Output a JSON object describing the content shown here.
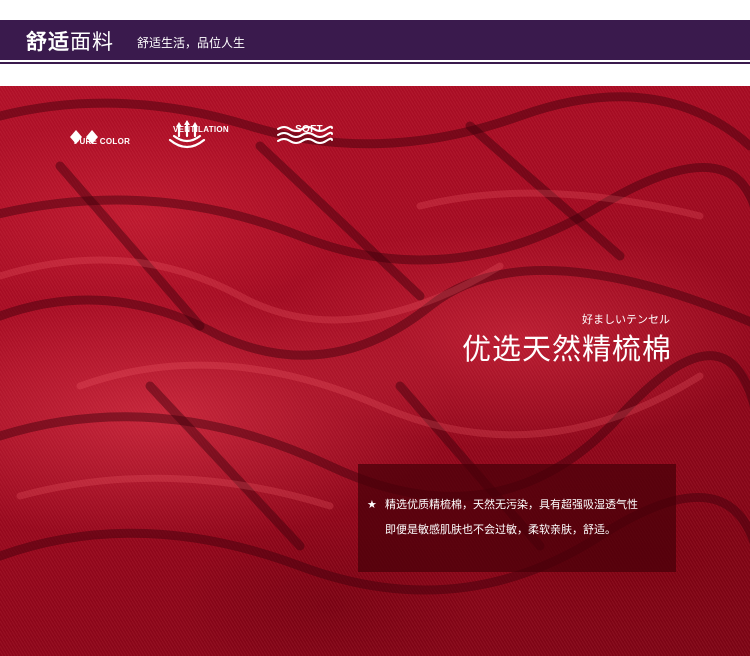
{
  "header": {
    "title_bold": "舒适",
    "title_normal": "面料",
    "subtitle": "舒适生活，品位人生"
  },
  "features": [
    {
      "icon": "diamonds-icon",
      "label": "PURE COLOR"
    },
    {
      "icon": "ventilation-icon",
      "label": "VENTILATION"
    },
    {
      "icon": "waves-icon",
      "label": "SOFT"
    }
  ],
  "fabric": {
    "kana": "好ましいテンセル",
    "title": "优选天然精梳棉",
    "description": [
      "精选优质精梳棉，天然无污染，具有超强吸湿透气性",
      "即便是敏感肌肤也不会过敏，柔软亲肤，舒适。"
    ]
  },
  "colors": {
    "header_bg": "#3a1a4d",
    "fabric_red": "#a40b22",
    "text": "#ffffff"
  }
}
